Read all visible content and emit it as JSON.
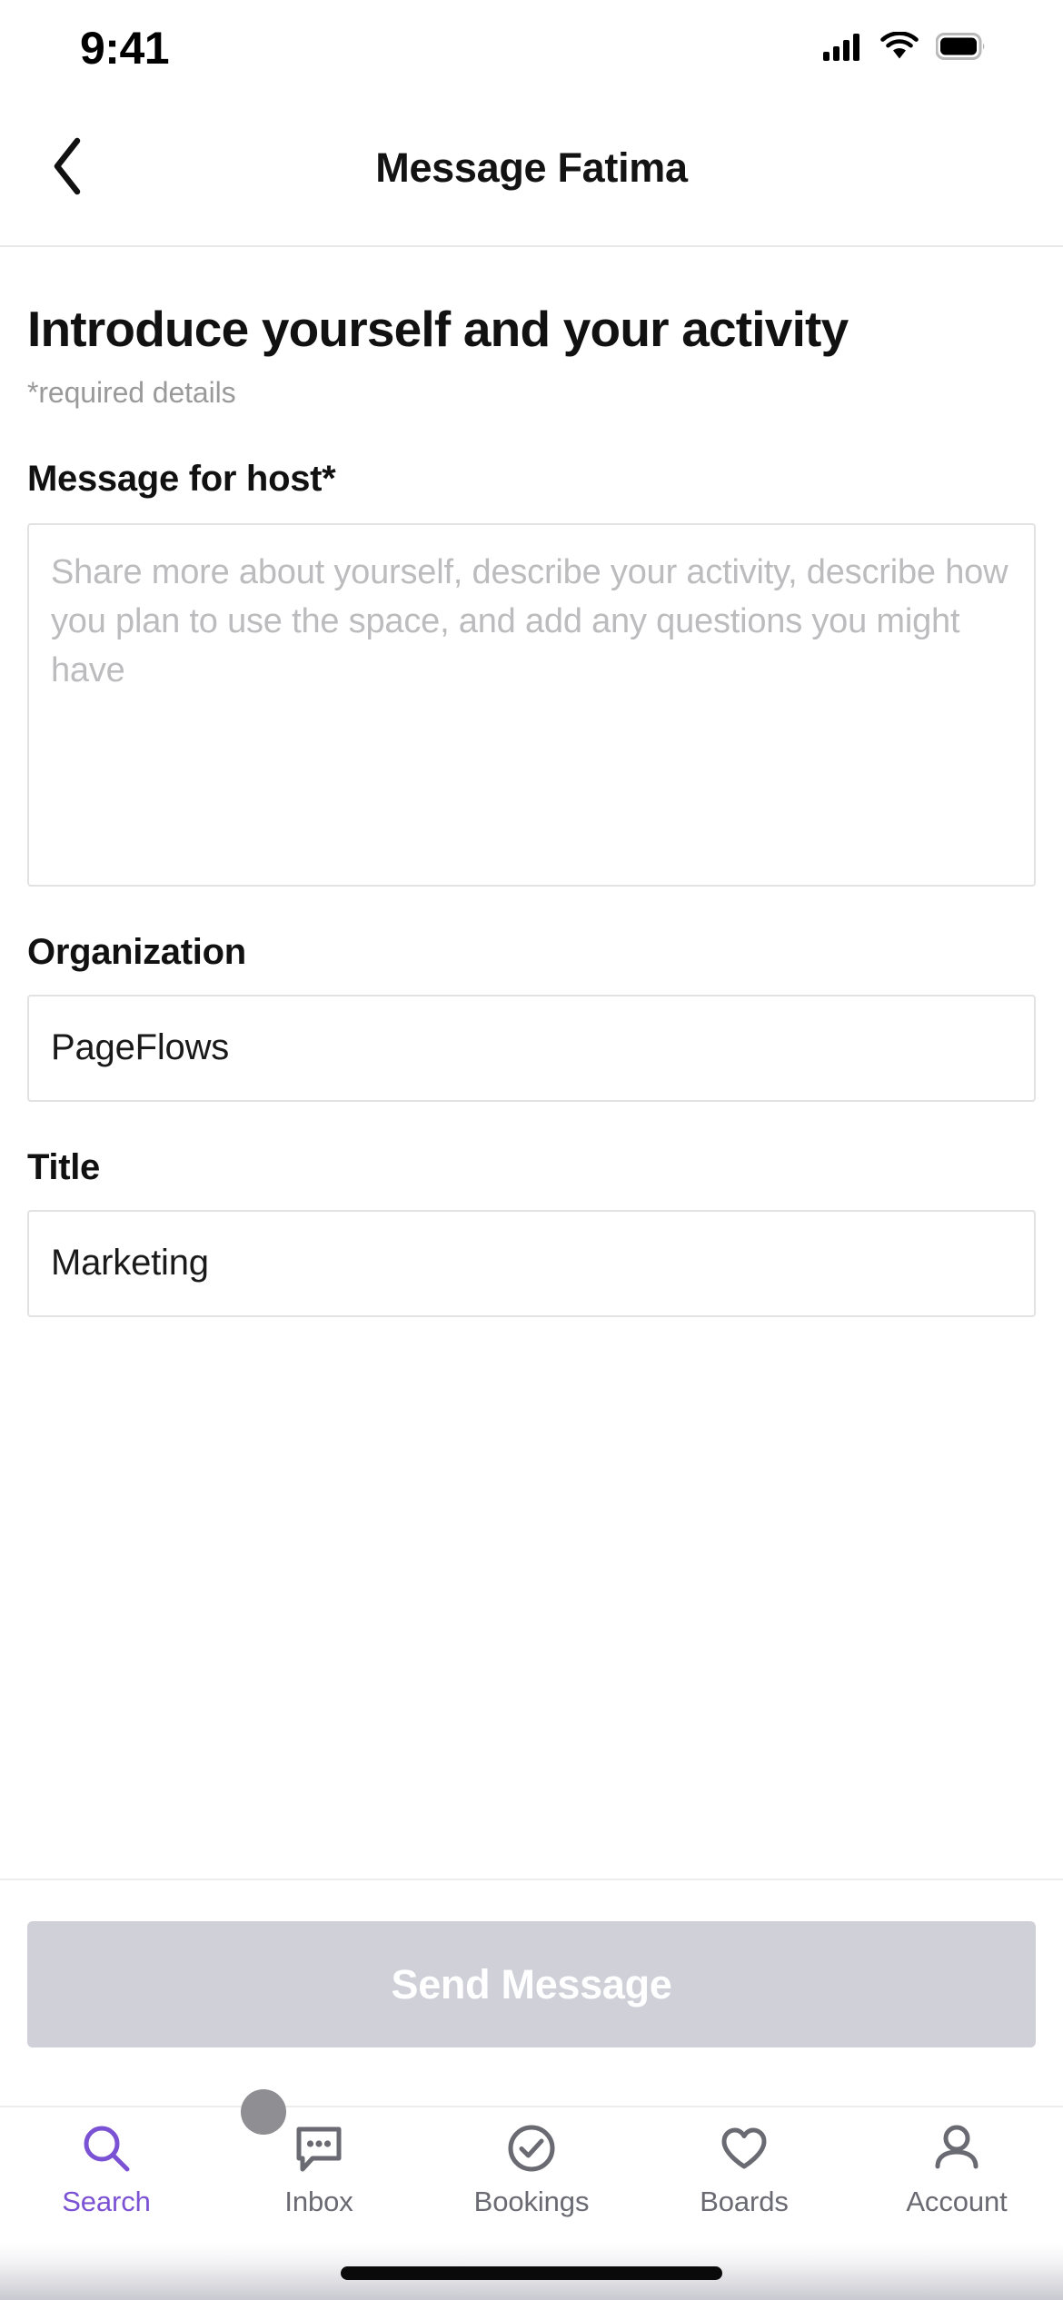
{
  "status_bar": {
    "time": "9:41",
    "icons": [
      "cellular-signal-icon",
      "wifi-icon",
      "battery-icon"
    ]
  },
  "nav": {
    "back_icon": "chevron-left-icon",
    "title": "Message Fatima"
  },
  "main": {
    "heading": "Introduce yourself and your activity",
    "required_note": "*required details",
    "fields": {
      "message": {
        "label": "Message for host*",
        "placeholder": "Share more about yourself, describe your activity, describe how you plan to use the space, and add any questions you might have",
        "value": ""
      },
      "organization": {
        "label": "Organization",
        "value": "PageFlows",
        "placeholder": ""
      },
      "title": {
        "label": "Title",
        "value": "Marketing",
        "placeholder": ""
      }
    }
  },
  "footer": {
    "send_label": "Send Message",
    "send_disabled": true,
    "send_bg": "#cfd0d8",
    "send_text_color": "#ffffff"
  },
  "tabbar": {
    "active_color": "#7B52D3",
    "inactive_color": "#6a6a72",
    "items": [
      {
        "label": "Search",
        "icon": "search-icon",
        "active": true
      },
      {
        "label": "Inbox",
        "icon": "chat-bubble-icon",
        "active": false
      },
      {
        "label": "Bookings",
        "icon": "check-circle-icon",
        "active": false
      },
      {
        "label": "Boards",
        "icon": "heart-icon",
        "active": false
      },
      {
        "label": "Account",
        "icon": "person-icon",
        "active": false
      }
    ]
  }
}
